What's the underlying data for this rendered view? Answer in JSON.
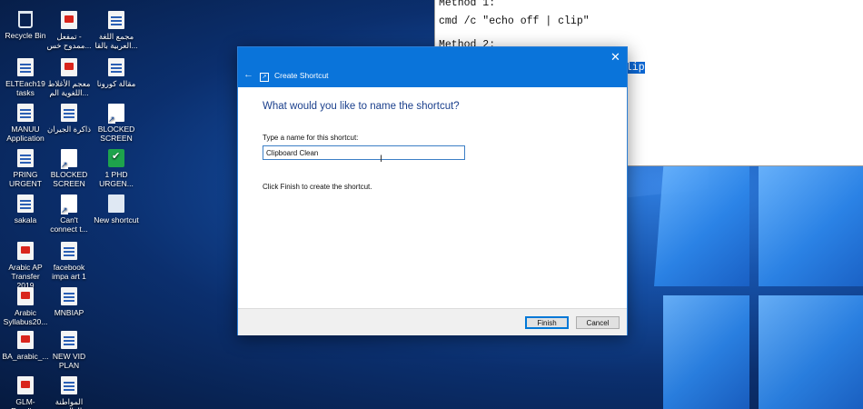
{
  "desktop": {
    "icons": [
      {
        "label": "Recycle Bin",
        "kind": "bin"
      },
      {
        "label": "تمفعل -\nممدوح خس...",
        "kind": "pdf"
      },
      {
        "label": "مجمع اللغة\nالعربية بالقا...",
        "kind": "doc"
      },
      {
        "label": "ELTEach19\ntasks",
        "kind": "doc"
      },
      {
        "label": "معجم الأغلاط\nاللغوية الم...",
        "kind": "pdf"
      },
      {
        "label": "مقالة كورونا",
        "kind": "doc"
      },
      {
        "label": "MANUU\nApplication",
        "kind": "doc"
      },
      {
        "label": "ذاكرة الجيران",
        "kind": "doc"
      },
      {
        "label": "BLOCKED\nSCREEN",
        "kind": "shortcut"
      },
      {
        "label": "PRING\nURGENT",
        "kind": "doc"
      },
      {
        "label": "BLOCKED\nSCREEN",
        "kind": "shortcut"
      },
      {
        "label": "1 PHD\nURGEN...",
        "kind": "check"
      },
      {
        "label": "sakala",
        "kind": "doc"
      },
      {
        "label": "Can't\nconnect t...",
        "kind": "shortcut"
      },
      {
        "label": "New shortcut",
        "kind": "blank"
      },
      {
        "label": "Arabic AP\nTransfer 2019",
        "kind": "pdf"
      },
      {
        "label": "facebook\nimpa art 1",
        "kind": "doc"
      },
      {
        "label": "Arabic\nSyllabus20...",
        "kind": "pdf"
      },
      {
        "label": "MNBIAP",
        "kind": "doc"
      },
      {
        "label": "BA_arabic_...",
        "kind": "pdf"
      },
      {
        "label": "NEW VID\nPLAN",
        "kind": "doc"
      },
      {
        "label": "GLM-Reading\nArabic Liter...",
        "kind": "pdf"
      },
      {
        "label": "المواطنة\nالعالمية بد...",
        "kind": "doc"
      }
    ]
  },
  "notepad": {
    "line1": "Method 1:",
    "line2": "cmd /c \"echo off | clip\"",
    "line3": "Method 2:",
    "selected": "clip"
  },
  "dialog": {
    "title": "Create Shortcut",
    "app_icon_text": "↗",
    "back_glyph": "←",
    "close_glyph": "✕",
    "heading": "What would you like to name the shortcut?",
    "field_label": "Type a name for this shortcut:",
    "name_value": "Clipboard Clean",
    "hint": "Click Finish to create the shortcut.",
    "finish_label": "Finish",
    "cancel_label": "Cancel",
    "accent_color": "#0a74da"
  }
}
